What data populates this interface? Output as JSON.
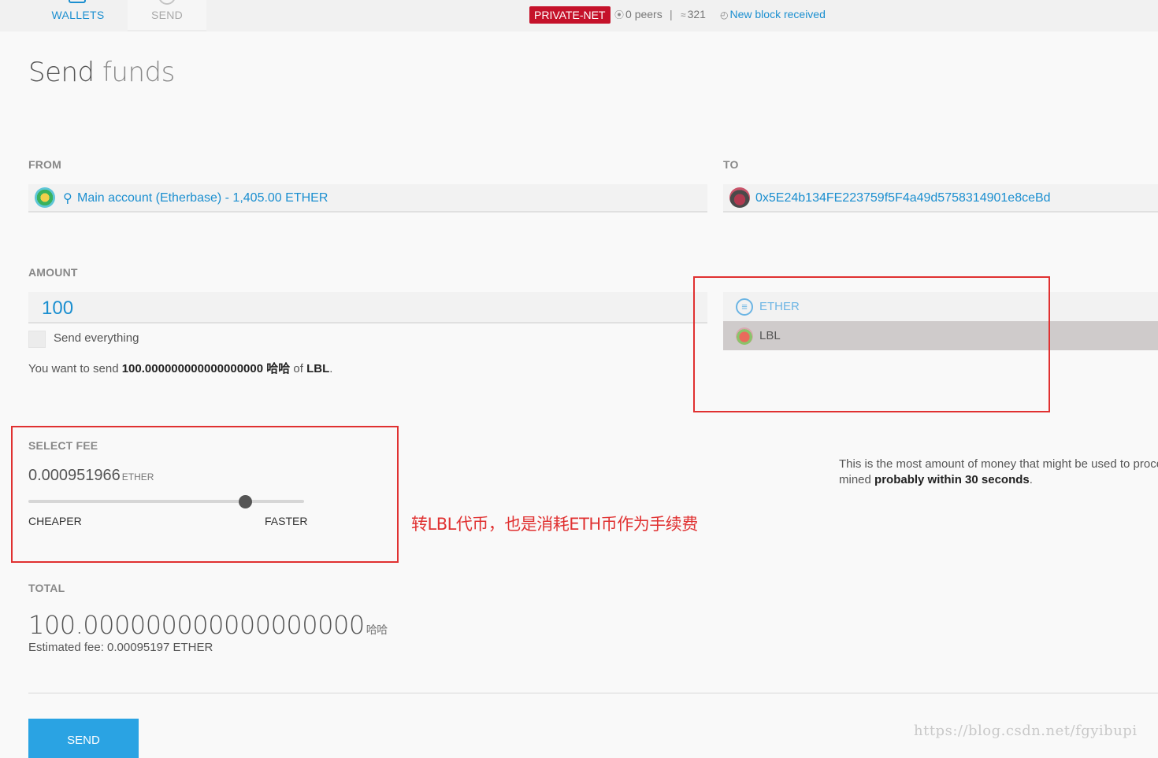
{
  "nav": {
    "wallets_label": "WALLETS",
    "send_label": "SEND"
  },
  "status_bar": {
    "network_badge": "PRIVATE-NET",
    "peers": "0 peers",
    "separator": "|",
    "block_number": "321",
    "block_message": "New block received",
    "icons": [
      "signal-icon",
      "layers-icon",
      "clock-icon"
    ]
  },
  "page": {
    "title_strong": "Send",
    "title_light": "funds"
  },
  "from": {
    "label": "FROM",
    "account_text": "Main account (Etherbase) - 1,405.00 ETHER"
  },
  "to": {
    "label": "TO",
    "address": "0x5E24b134FE223759f5F4a49d5758314901e8ceBd"
  },
  "amount": {
    "label": "AMOUNT",
    "value": "100",
    "send_everything_label": "Send everything",
    "summary_prefix": "You want to send",
    "summary_amount": "100.000000000000000000 哈哈",
    "summary_of": "of",
    "summary_token": "LBL",
    "summary_end": "."
  },
  "tokens": [
    {
      "name": "ETHER",
      "icon": "ether-icon",
      "selected": false
    },
    {
      "name": "LBL",
      "icon": "token-identicon",
      "selected": true
    }
  ],
  "fee": {
    "label": "SELECT FEE",
    "value": "0.000951966",
    "unit": "ETHER",
    "slider_position": 0.787,
    "cheaper_label": "CHEAPER",
    "faster_label": "FASTER",
    "note_line1": "This is the most amount of money that might be used to proces",
    "note_line2_prefix": "mined",
    "note_line2_bold": "probably within 30 seconds",
    "note_line2_end": "."
  },
  "annotation": {
    "text": "转LBL代币，也是消耗ETH币作为手续费",
    "color": "#e03131"
  },
  "total": {
    "label": "TOTAL",
    "value": "100.000000000000000000",
    "unit": "哈哈",
    "estimated_fee": "Estimated fee: 0.00095197 ETHER"
  },
  "send_button": {
    "label": "SEND"
  },
  "watermark": "https://blog.csdn.net/fgyibupi",
  "colors": {
    "accent": "#1b8fd0",
    "send_button": "#2aa3e3",
    "network_badge": "#c5122a",
    "selected_token_bg": "#cfcbcb"
  }
}
